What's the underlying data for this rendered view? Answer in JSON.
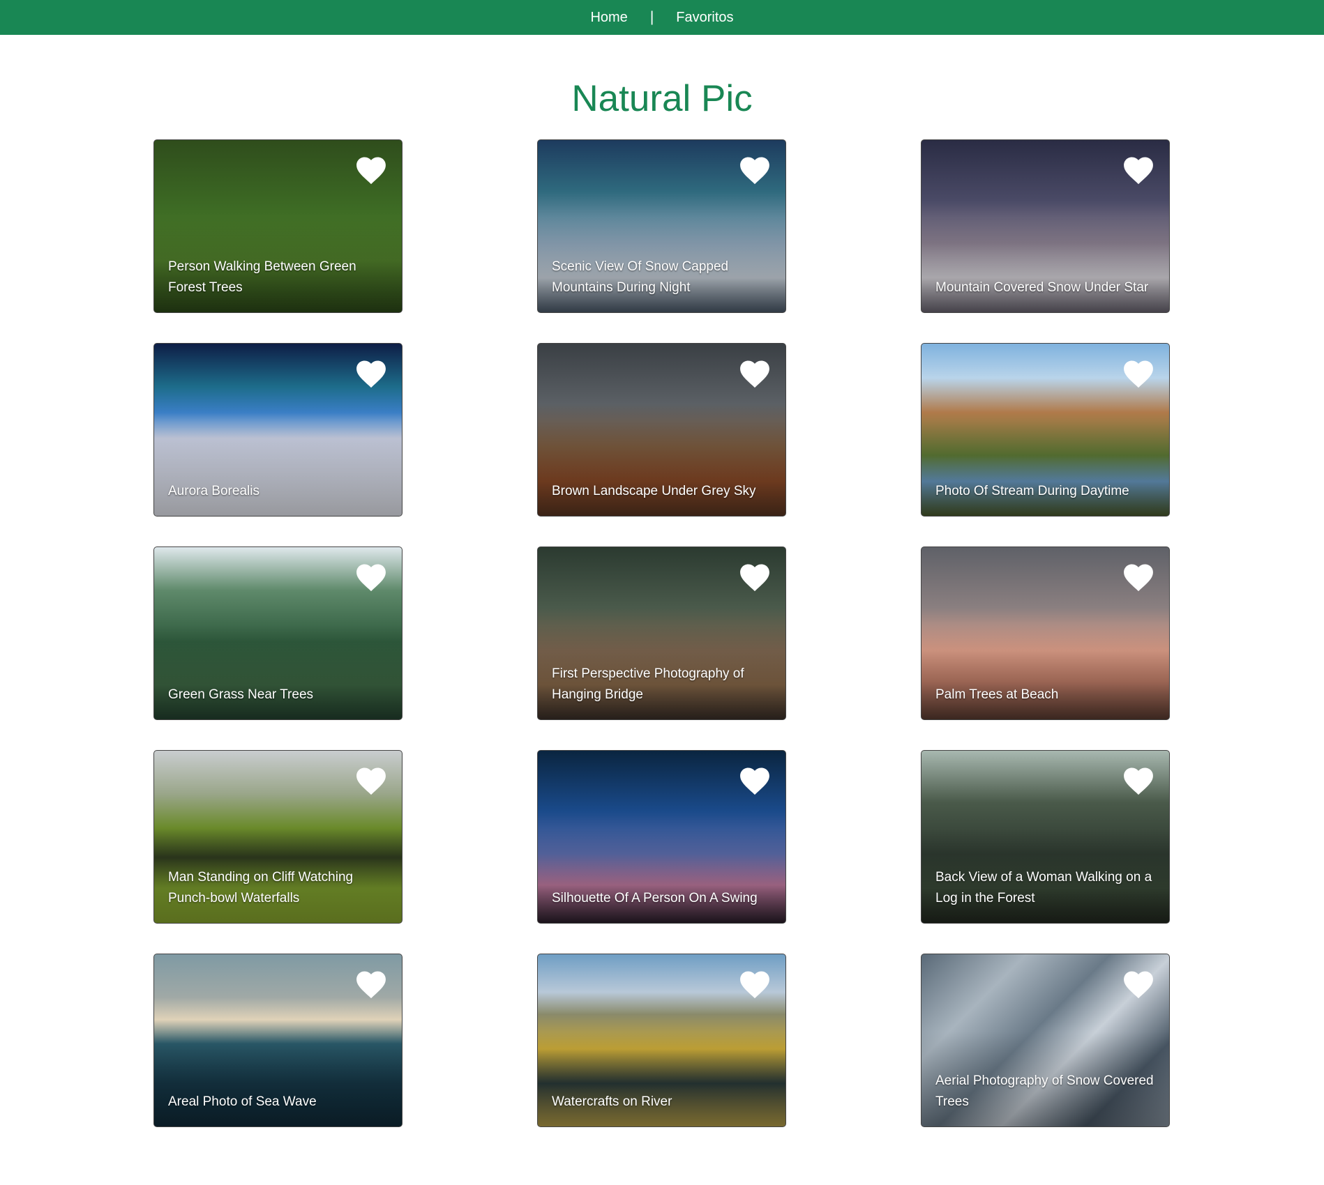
{
  "nav": {
    "home_label": "Home",
    "separator": "|",
    "favorites_label": "Favoritos"
  },
  "page": {
    "title": "Natural Pic"
  },
  "colors": {
    "brand": "#198754",
    "heart": "#ffffff"
  },
  "photos": [
    {
      "caption": "Person Walking Between Green Forest Trees",
      "bg": "linear-gradient(180deg,#2f4d1c 0%,#3d6b24 40%,#4f7d2a 70%,#2d4a18 100%)"
    },
    {
      "caption": "Scenic View Of Snow Capped Mountains During Night",
      "bg": "linear-gradient(180deg,#1d3b5e 0%,#2f6a7e 30%,#8da4b8 60%,#c8d1da 80%,#4b5a6a 100%)"
    },
    {
      "caption": "Mountain Covered Snow Under Star",
      "bg": "linear-gradient(180deg,#2a2c44 0%,#4a4a66 35%,#8a7f8f 60%,#d9d6dc 80%,#6b6672 100%)"
    },
    {
      "caption": "Aurora Borealis",
      "bg": "linear-gradient(180deg,#0e1e46 0%,#1d6c8a 25%,#3a7ec5 40%,#c7cde0 55%,#e8eaf2 100%)"
    },
    {
      "caption": "Brown Landscape Under Grey Sky",
      "bg": "linear-gradient(180deg,#3a3f44 0%,#5b6065 35%,#7a5a3e 60%,#8b4a27 80%,#5a3521 100%)"
    },
    {
      "caption": "Photo Of Stream During Daytime",
      "bg": "linear-gradient(180deg,#7fb2de 0%,#b9d4ea 20%,#b07a4a 40%,#5d7a36 65%,#6a9bc4 80%,#4a5a2a 100%)"
    },
    {
      "caption": "Green Grass Near Trees",
      "bg": "linear-gradient(180deg,#dfe8ec 0%,#5f8a6b 25%,#2f5b3d 55%,#3f6a45 80%,#244330 100%)"
    },
    {
      "caption": "First Perspective Photography of Hanging Bridge",
      "bg": "linear-gradient(180deg,#2b3a30 0%,#4a5a4b 35%,#7d6650 60%,#8a6a4a 80%,#3a2f28 100%)"
    },
    {
      "caption": "Palm Trees at Beach",
      "bg": "linear-gradient(180deg,#5f6168 0%,#8a7f80 35%,#e0a08a 60%,#c4806a 78%,#5a3b30 100%)"
    },
    {
      "caption": "Man Standing on Cliff Watching Punch-bowl Waterfalls",
      "bg": "linear-gradient(180deg,#c9cdcf 0%,#9aa68a 25%,#6a8a2a 45%,#2e3a1e 62%,#7ea02e 80%,#8aa82e 100%)"
    },
    {
      "caption": "Silhouette Of A Person On A Swing",
      "bg": "linear-gradient(180deg,#0a2540 0%,#1a4a8a 35%,#5a6aa8 60%,#c07aa0 78%,#2a1e2a 100%)"
    },
    {
      "caption": "Back View of a Woman Walking on a Log in the Forest",
      "bg": "linear-gradient(180deg,#a8b8b0 0%,#4a5a4a 30%,#2e3a30 60%,#3a4a38 80%,#22281f 100%)"
    },
    {
      "caption": "Areal Photo of Sea Wave",
      "bg": "linear-gradient(180deg,#7f9aa4 0%,#a0a9a6 25%,#e0d2b8 38%,#2a5a6a 52%,#163848 75%,#0f2a38 100%)"
    },
    {
      "caption": "Watercrafts on River",
      "bg": "linear-gradient(180deg,#6f9ec4 0%,#b8c8d8 22%,#8a8a6a 35%,#c8a838 55%,#2a3a3a 75%,#b8a048 100%)"
    },
    {
      "caption": "Aerial Photography of Snow Covered Trees",
      "bg": "linear-gradient(135deg,#5a6a78 0%,#a8b4be 25%,#6a7a88 45%,#c8d0d8 60%,#4a5866 80%,#8a96a2 100%)"
    }
  ]
}
